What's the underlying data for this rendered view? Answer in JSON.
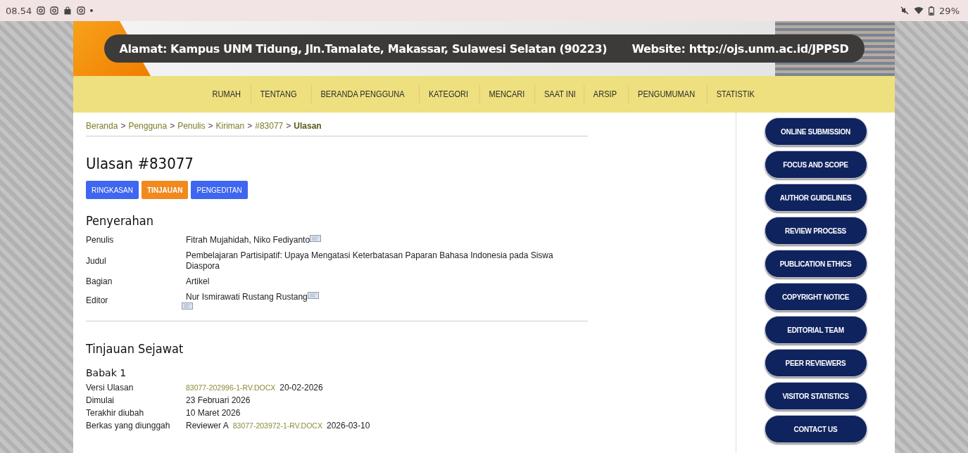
{
  "status_bar": {
    "time": "08.54",
    "battery": "29%"
  },
  "header": {
    "address": "Alamat: Kampus UNM Tidung, Jln.Tamalate, Makassar, Sulawesi Selatan (90223)",
    "website": "Website: http://ojs.unm.ac.id/JPPSD"
  },
  "nav": [
    "RUMAH",
    "TENTANG",
    "BERANDA PENGGUNA",
    "KATEGORI",
    "MENCARI",
    "SAAT INI",
    "ARSIP",
    "PENGUMUMAN",
    "STATISTIK"
  ],
  "breadcrumb": [
    {
      "label": "Beranda",
      "current": false
    },
    {
      "label": "Pengguna",
      "current": false
    },
    {
      "label": "Penulis",
      "current": false
    },
    {
      "label": "Kiriman",
      "current": false
    },
    {
      "label": "#83077",
      "current": false
    },
    {
      "label": "Ulasan",
      "current": true
    }
  ],
  "breadcrumb_separator": ">",
  "title": "Ulasan #83077",
  "tabs": [
    {
      "label": "RINGKASAN",
      "selected": false
    },
    {
      "label": "TINJAUAN",
      "selected": true
    },
    {
      "label": "PENGEDITAN",
      "selected": false
    }
  ],
  "submission": {
    "heading": "Penyerahan",
    "rows": [
      {
        "label": "Penulis",
        "lines": [
          {
            "text": "Fitrah Mujahidah, Niko Fediyanto",
            "email_icon": true
          }
        ]
      },
      {
        "label": "Judul",
        "lines": [
          {
            "text": "Pembelajaran Partisipatif: Upaya Mengatasi Keterbatasan Paparan Bahasa Indonesia pada Siswa Diaspora",
            "email_icon": false
          }
        ]
      },
      {
        "label": "Bagian",
        "lines": [
          {
            "text": "Artikel",
            "email_icon": false
          }
        ]
      },
      {
        "label": "Editor",
        "lines": [
          {
            "text": "Nur Ismirawati Rustang Rustang",
            "email_icon": true
          },
          {
            "email_icon": true
          }
        ]
      }
    ]
  },
  "peer_review": {
    "heading": "Tinjauan Sejawat",
    "round": "Babak 1",
    "rows": [
      {
        "label": "Versi Ulasan",
        "parts": [
          {
            "kind": "link",
            "text": "83077-202996-1-RV.DOCX"
          },
          {
            "kind": "text",
            "text": "20-02-2026"
          }
        ]
      },
      {
        "label": "Dimulai",
        "parts": [
          {
            "kind": "text",
            "text": "23 Februari 2026"
          }
        ]
      },
      {
        "label": "Terakhir diubah",
        "parts": [
          {
            "kind": "text",
            "text": "10 Maret 2026"
          }
        ]
      },
      {
        "label": "Berkas yang diunggah",
        "parts": [
          {
            "kind": "text",
            "text": "Reviewer A"
          },
          {
            "kind": "link",
            "text": "83077-203972-1-RV.DOCX"
          },
          {
            "kind": "text",
            "text": "2026-03-10"
          }
        ]
      }
    ]
  },
  "sidebar": [
    "ONLINE SUBMISSION",
    "FOCUS AND SCOPE",
    "AUTHOR GUIDELINES",
    "REVIEW PROCESS",
    "PUBLICATION ETHICS",
    "COPYRIGHT NOTICE",
    "EDITORIAL TEAM",
    "PEER REVIEWERS",
    "VISITOR STATISTICS",
    "CONTACT US"
  ]
}
